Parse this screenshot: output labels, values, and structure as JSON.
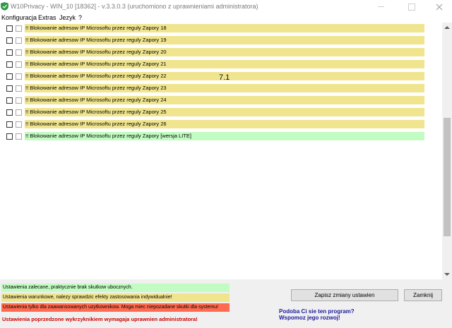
{
  "window": {
    "title": "W10Privacy - WIN_10 [18362]  - v.3.3.0.3 (uruchomiono z uprawnieniami administratora)"
  },
  "menu": {
    "items": [
      "Konfiguracja",
      "Extras",
      "Jezyk",
      "?"
    ]
  },
  "list": {
    "rows": [
      {
        "label": "!! Blokowanie adresow IP Microsoftu przez reguly Zapory 18",
        "status": "yellow",
        "checked": false
      },
      {
        "label": "!! Blokowanie adresow IP Microsoftu przez reguly Zapory 19",
        "status": "yellow",
        "checked": false
      },
      {
        "label": "!! Blokowanie adresow IP Microsoftu przez reguly Zapory 20",
        "status": "yellow",
        "checked": false
      },
      {
        "label": "!! Blokowanie adresow IP Microsoftu przez reguly Zapory 21",
        "status": "yellow",
        "checked": false
      },
      {
        "label": "!! Blokowanie adresow IP Microsoftu przez reguly Zapory 22",
        "status": "yellow",
        "checked": false
      },
      {
        "label": "!! Blokowanie adresow IP Microsoftu przez reguly Zapory 23",
        "status": "yellow",
        "checked": false
      },
      {
        "label": "!! Blokowanie adresow IP Microsoftu przez reguly Zapory 24",
        "status": "yellow",
        "checked": false
      },
      {
        "label": "!! Blokowanie adresow IP Microsoftu przez reguly Zapory 25",
        "status": "yellow",
        "checked": false
      },
      {
        "label": "!! Blokowanie adresow IP Microsoftu przez reguly Zapory 26",
        "status": "yellow",
        "checked": false
      },
      {
        "label": "!! Blokowanie adresow IP Microsoftu przez reguly Zapory [wersja LITE]",
        "status": "green",
        "checked": false
      }
    ]
  },
  "overlay": {
    "number": "7.1"
  },
  "legend": {
    "recommended": "Ustawienia zalecane, praktycznie brak skutkow ubocznych.",
    "conditional": "Ustawienia warunkowe, nalezy sprawdzic efekty zastosowania indywidualnie!",
    "advanced": "Ustawienia tylko dla zaawansowanych uzytkownikow. Moga miec niepozadane skutki dla systemu!",
    "admin_note": "Ustawienia poprzedzone wykrzyknikiem wymagaja uprawnien administratora!"
  },
  "buttons": {
    "save": "Zapisz zmiany ustawien",
    "close": "Zamknij"
  },
  "promo": {
    "line1": "Podoba Ci sie ten program?",
    "line2": "Wspomoz jego rozwoj!"
  },
  "colors": {
    "recommended": "#c2fcc2",
    "conditional": "#f0e58e",
    "advanced": "#ff6b50",
    "admin_note": "#cc0000",
    "promo": "#1a1a9c"
  }
}
